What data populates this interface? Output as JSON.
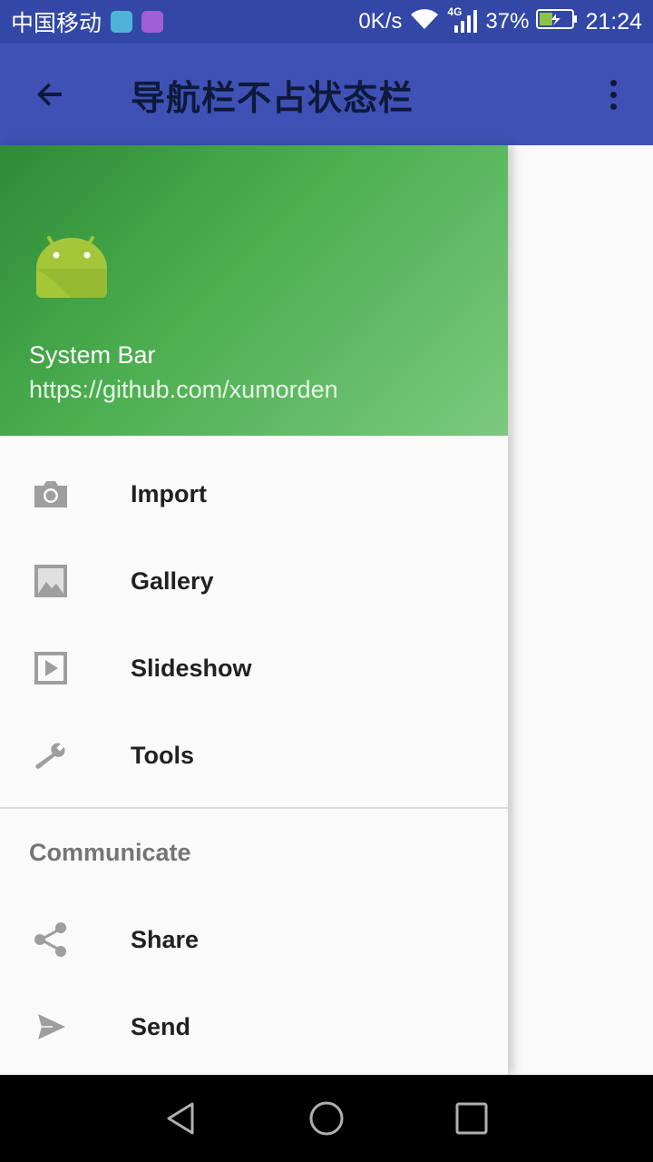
{
  "status_bar": {
    "carrier": "中国移动",
    "net_speed": "0K/s",
    "network": "4G",
    "battery": "37%",
    "time": "21:24"
  },
  "toolbar": {
    "title": "导航栏不占状态栏"
  },
  "drawer_header": {
    "title": "System Bar",
    "subtitle": "https://github.com/xumorden"
  },
  "menu": {
    "items": [
      {
        "label": "Import",
        "icon": "camera-icon"
      },
      {
        "label": "Gallery",
        "icon": "gallery-icon"
      },
      {
        "label": "Slideshow",
        "icon": "slideshow-icon"
      },
      {
        "label": "Tools",
        "icon": "wrench-icon"
      }
    ],
    "section_title": "Communicate",
    "section_items": [
      {
        "label": "Share",
        "icon": "share-icon"
      },
      {
        "label": "Send",
        "icon": "send-icon"
      }
    ]
  },
  "colors": {
    "status_bar": "#3347a6",
    "toolbar": "#3f51b5",
    "header_green": "#4caf50",
    "icon_grey": "#9e9e9e"
  }
}
